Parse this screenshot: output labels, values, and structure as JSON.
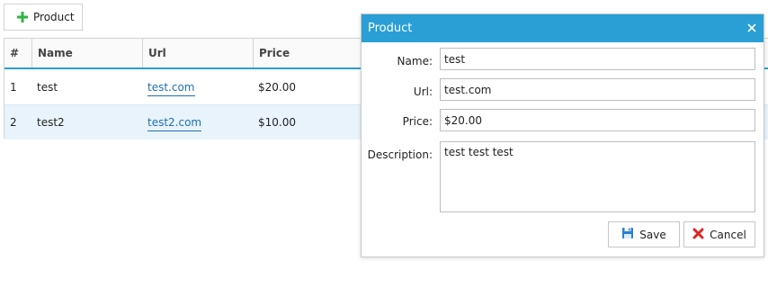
{
  "toolbar": {
    "add_label": "Product"
  },
  "grid": {
    "headers": [
      "#",
      "Name",
      "Url",
      "Price"
    ],
    "rows": [
      {
        "id": "1",
        "name": "test",
        "url": "test.com",
        "price": "$20.00"
      },
      {
        "id": "2",
        "name": "test2",
        "url": "test2.com",
        "price": "$10.00"
      }
    ]
  },
  "dialog": {
    "title": "Product",
    "labels": {
      "name": "Name:",
      "url": "Url:",
      "price": "Price:",
      "description": "Description:"
    },
    "values": {
      "name": "test",
      "url": "test.com",
      "price": "$20.00",
      "description": "test test test"
    },
    "save_label": "Save",
    "cancel_label": "Cancel"
  },
  "colors": {
    "accent": "#2a9fd6",
    "link": "#1f6fb0",
    "selected_row": "#e8f3fb",
    "add": "#2fb345",
    "cancel": "#e02424"
  }
}
